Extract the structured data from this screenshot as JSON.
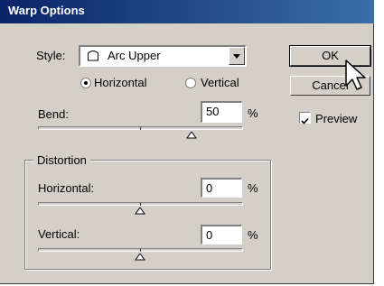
{
  "window": {
    "title": "Warp Options"
  },
  "style": {
    "label": "Style:",
    "value": "Arc Upper"
  },
  "orientation": {
    "horizontal_label": "Horizontal",
    "vertical_label": "Vertical",
    "selected": "Horizontal"
  },
  "bend": {
    "label": "Bend:",
    "value": "50",
    "unit": "%",
    "slider_value": 50
  },
  "distortion": {
    "legend": "Distortion",
    "horizontal": {
      "label": "Horizontal:",
      "value": "0",
      "unit": "%",
      "slider_value": 0
    },
    "vertical": {
      "label": "Vertical:",
      "value": "0",
      "unit": "%",
      "slider_value": 0
    }
  },
  "buttons": {
    "ok": "OK",
    "cancel": "Cancel"
  },
  "preview": {
    "label": "Preview",
    "checked": true
  },
  "colors": {
    "titlebar_start": "#0a246a",
    "titlebar_end": "#3a6ea5",
    "dialog_bg": "#d4d0c8"
  }
}
